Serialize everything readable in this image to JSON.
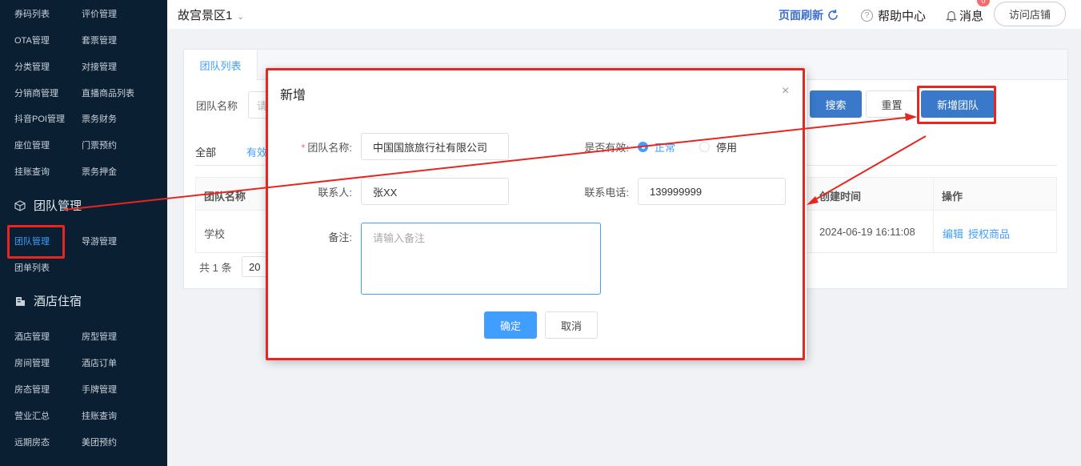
{
  "sidebar": {
    "rows_top": [
      [
        "券码列表",
        "评价管理"
      ],
      [
        "OTA管理",
        "套票管理"
      ],
      [
        "分类管理",
        "对接管理"
      ],
      [
        "分销商管理",
        "直播商品列表"
      ],
      [
        "抖音POI管理",
        "票务财务"
      ],
      [
        "座位管理",
        "门票预约"
      ],
      [
        "挂账查询",
        "票务押金"
      ]
    ],
    "section_team": "团队管理",
    "team_items": [
      "团队管理",
      "导游管理"
    ],
    "team_list": "团单列表",
    "section_hotel": "酒店住宿",
    "rows_hotel": [
      [
        "酒店管理",
        "房型管理"
      ],
      [
        "房间管理",
        "酒店订单"
      ],
      [
        "房态管理",
        "手牌管理"
      ],
      [
        "营业汇总",
        "挂账查询"
      ],
      [
        "远期房态",
        "美团预约"
      ]
    ]
  },
  "header": {
    "scenic": "故宫景区1",
    "refresh": "页面刷新",
    "help": "帮助中心",
    "messages": "消息",
    "badge": "0",
    "visit": "访问店铺"
  },
  "page": {
    "tab": "团队列表",
    "filter_label": "团队名称",
    "filter_placeholder": "请",
    "search": "搜索",
    "reset": "重置",
    "add_team": "新增团队",
    "subtab_all": "全部",
    "subtab_valid": "有效",
    "columns": {
      "name": "团队名称",
      "created": "创建时间",
      "ops": "操作"
    },
    "row": {
      "name": "学校",
      "created": "2024-06-19 16:11:08",
      "edit": "编辑",
      "grant": "授权商品"
    },
    "total": "共 1 条",
    "page_size": "20"
  },
  "dialog": {
    "title": "新增",
    "close": "×",
    "team_name_label": "团队名称:",
    "team_name_value": "中国国旅旅行社有限公司",
    "valid_label": "是否有效:",
    "radio_normal": "正常",
    "radio_disabled": "停用",
    "contact_label": "联系人:",
    "contact_value": "张XX",
    "phone_label": "联系电话:",
    "phone_value": "139999999",
    "remark_label": "备注:",
    "remark_placeholder": "请输入备注",
    "confirm": "确定",
    "cancel": "取消"
  },
  "colors": {
    "accent": "#409eff",
    "sidebar": "#0b1f33",
    "annotation": "#e8251f"
  }
}
